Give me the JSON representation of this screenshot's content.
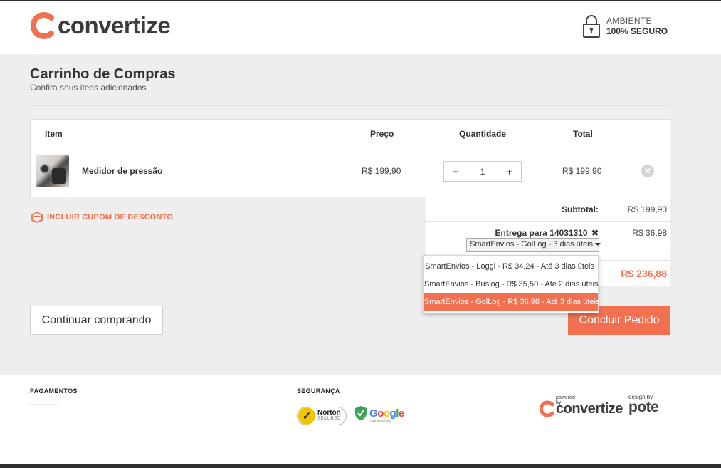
{
  "header": {
    "brand": "convertize",
    "security_line1": "AMBIENTE",
    "security_line2": "100% SEGURO"
  },
  "page": {
    "title": "Carrinho de Compras",
    "subtitle": "Confira seus itens adicionados"
  },
  "table": {
    "headers": {
      "item": "Item",
      "price": "Preço",
      "quantity": "Quantidade",
      "total": "Total"
    },
    "rows": [
      {
        "name": "Medidor de pressão",
        "price": "R$ 199,90",
        "quantity": "1",
        "total": "R$ 199,90"
      }
    ]
  },
  "qty_controls": {
    "minus": "−",
    "plus": "+"
  },
  "coupon": {
    "label": "INCLUIR CUPOM DE DESCONTO"
  },
  "summary": {
    "subtotal_label": "Subtotal:",
    "subtotal_value": "R$ 199,90",
    "shipping_label": "Entrega para 14031310",
    "shipping_remove": "✖",
    "shipping_value": "R$ 36,98",
    "shipping_selected": "SmartEnvios - GolLog - 3 dias úteis",
    "grand_total": "R$ 236,88"
  },
  "shipping_options": [
    {
      "label": "SmartEnvios - Loggi - R$ 34,24 - Até 3 dias úteis",
      "selected": false
    },
    {
      "label": "SmartEnvios - Buslog - R$ 35,50 - Até 2 dias úteis",
      "selected": false
    },
    {
      "label": "SmartEnvios - GolLog - R$ 36,98 - Até 3 dias úteis",
      "selected": true
    }
  ],
  "buttons": {
    "continue": "Continuar comprando",
    "finish": "Concluir Pedido"
  },
  "footer": {
    "payments_heading": "PAGAMENTOS",
    "security_heading": "SEGURANÇA",
    "norton_title": "Norton",
    "norton_sub": "SECURED",
    "google_word": "Google",
    "google_sub": "Safe Browsing",
    "powered_by": "powered by",
    "powered_brand": "convertize",
    "design_by": "design by",
    "design_brand": "pote"
  },
  "colors": {
    "accent": "#f0704f",
    "background_main": "#eeeeee",
    "text_dark": "#333333"
  },
  "icons": [
    "convertize-logo-icon",
    "padlock-icon",
    "remove-item-icon",
    "coupon-tag-icon",
    "dropdown-caret-icon",
    "norton-check-icon",
    "google-shield-icon"
  ]
}
